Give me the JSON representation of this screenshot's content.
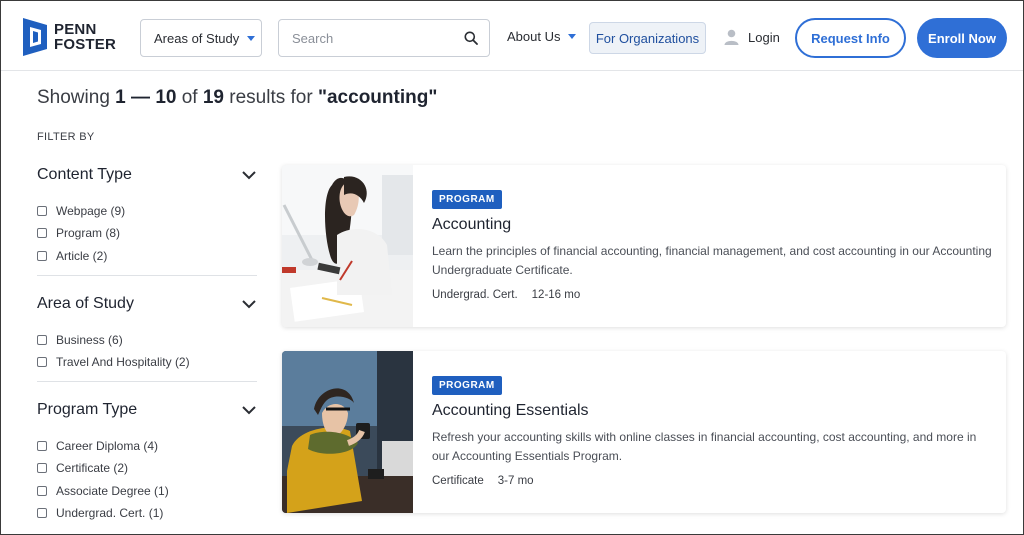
{
  "header": {
    "logo": {
      "line1": "PENN",
      "line2": "FOSTER"
    },
    "areas_of_study": "Areas of Study",
    "search_placeholder": "Search",
    "about_us": "About Us",
    "for_organizations": "For Organizations",
    "login": "Login",
    "request_info": "Request Info",
    "enroll_now": "Enroll Now"
  },
  "results": {
    "prefix": "Showing ",
    "range_start": "1",
    "range_sep": " — ",
    "range_end": "10",
    "of_text": " of ",
    "total": "19",
    "for_text": " results for ",
    "query": "\"accounting\""
  },
  "filters": {
    "label": "FILTER BY",
    "groups": [
      {
        "title": "Content Type",
        "options": [
          "Webpage (9)",
          "Program (8)",
          "Article (2)"
        ]
      },
      {
        "title": "Area of Study",
        "options": [
          "Business (6)",
          "Travel And Hospitality (2)"
        ]
      },
      {
        "title": "Program Type",
        "options": [
          "Career Diploma (4)",
          "Certificate (2)",
          "Associate Degree (1)",
          "Undergrad. Cert. (1)"
        ]
      }
    ]
  },
  "cards": [
    {
      "badge": "PROGRAM",
      "title": "Accounting",
      "description": "Learn the principles of financial accounting, financial management, and cost accounting in our Accounting Undergraduate Certificate.",
      "credential": "Undergrad. Cert.",
      "duration": "12-16 mo"
    },
    {
      "badge": "PROGRAM",
      "title": "Accounting Essentials",
      "description": "Refresh your accounting skills with online classes in financial accounting, cost accounting, and more in our Accounting Essentials Program.",
      "credential": "Certificate",
      "duration": "3-7 mo"
    }
  ],
  "colors": {
    "accent": "#2f6fd6",
    "badge": "#1f5fbf",
    "logo_blue": "#1f5fbf"
  },
  "icons": {
    "search": "search-icon",
    "caret": "caret-down-icon",
    "user": "user-icon",
    "chevron": "chevron-down-icon"
  }
}
